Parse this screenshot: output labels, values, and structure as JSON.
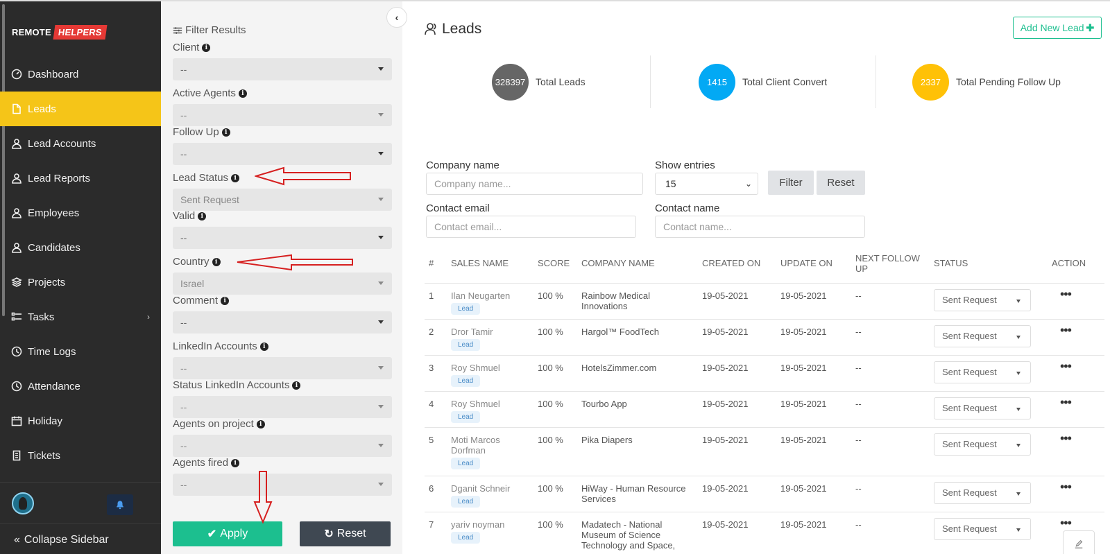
{
  "brand": {
    "part1": "REMOTE",
    "part2": "HELPERS"
  },
  "sidebar": {
    "items": [
      {
        "label": "Dashboard",
        "icon": "gauge-icon"
      },
      {
        "label": "Leads",
        "icon": "file-icon"
      },
      {
        "label": "Lead Accounts",
        "icon": "user-icon"
      },
      {
        "label": "Lead Reports",
        "icon": "user-icon"
      },
      {
        "label": "Employees",
        "icon": "user-icon"
      },
      {
        "label": "Candidates",
        "icon": "user-icon"
      },
      {
        "label": "Projects",
        "icon": "layers-icon"
      },
      {
        "label": "Tasks",
        "icon": "tasks-icon"
      },
      {
        "label": "Time Logs",
        "icon": "clock-icon"
      },
      {
        "label": "Attendance",
        "icon": "clock-icon"
      },
      {
        "label": "Holiday",
        "icon": "calendar-icon"
      },
      {
        "label": "Tickets",
        "icon": "ticket-icon"
      }
    ],
    "active": "Leads",
    "collapse_label": "Collapse Sidebar"
  },
  "filter": {
    "title": "Filter Results",
    "fields": [
      {
        "label": "Client",
        "value": "--"
      },
      {
        "label": "Active Agents",
        "value": "--"
      },
      {
        "label": "Follow Up",
        "value": "--"
      },
      {
        "label": "Lead Status",
        "value": "Sent Request"
      },
      {
        "label": "Valid",
        "value": "--"
      },
      {
        "label": "Country",
        "value": "Israel"
      },
      {
        "label": "Comment",
        "value": "--"
      },
      {
        "label": "LinkedIn Accounts",
        "value": "--"
      },
      {
        "label": "Status LinkedIn Accounts",
        "value": "--"
      },
      {
        "label": "Agents on project",
        "value": "--"
      },
      {
        "label": "Agents fired",
        "value": "--"
      }
    ],
    "apply_label": "Apply",
    "reset_label": "Reset"
  },
  "page": {
    "title": "Leads",
    "add_button": "Add New Lead"
  },
  "stats": [
    {
      "value": "328397",
      "label": "Total Leads",
      "color": "#666666"
    },
    {
      "value": "1415",
      "label": "Total Client Convert",
      "color": "#03a9f4"
    },
    {
      "value": "2337",
      "label": "Total Pending Follow Up",
      "color": "#ffc107"
    }
  ],
  "search": {
    "company_label": "Company name",
    "company_placeholder": "Company name...",
    "entries_label": "Show entries",
    "entries_value": "15",
    "filter_btn": "Filter",
    "reset_btn": "Reset",
    "email_label": "Contact email",
    "email_placeholder": "Contact email...",
    "contact_label": "Contact name",
    "contact_placeholder": "Contact name..."
  },
  "table": {
    "headers": [
      "#",
      "SALES NAME",
      "SCORE",
      "COMPANY NAME",
      "CREATED ON",
      "UPDATE ON",
      "NEXT FOLLOW UP",
      "STATUS",
      "ACTION"
    ],
    "badge": "Lead",
    "rows": [
      {
        "num": "1",
        "name": "Ilan Neugarten",
        "score": "100 %",
        "company": "Rainbow Medical Innovations",
        "created": "19-05-2021",
        "updated": "19-05-2021",
        "next": "--",
        "status": "Sent Request"
      },
      {
        "num": "2",
        "name": "Dror Tamir",
        "score": "100 %",
        "company": "Hargol™ FoodTech",
        "created": "19-05-2021",
        "updated": "19-05-2021",
        "next": "--",
        "status": "Sent Request"
      },
      {
        "num": "3",
        "name": "Roy Shmuel",
        "score": "100 %",
        "company": "HotelsZimmer.com",
        "created": "19-05-2021",
        "updated": "19-05-2021",
        "next": "--",
        "status": "Sent Request"
      },
      {
        "num": "4",
        "name": "Roy Shmuel",
        "score": "100 %",
        "company": "Tourbo App",
        "created": "19-05-2021",
        "updated": "19-05-2021",
        "next": "--",
        "status": "Sent Request"
      },
      {
        "num": "5",
        "name": "Moti Marcos Dorfman",
        "score": "100 %",
        "company": "Pika Diapers",
        "created": "19-05-2021",
        "updated": "19-05-2021",
        "next": "--",
        "status": "Sent Request"
      },
      {
        "num": "6",
        "name": "Dganit Schneir",
        "score": "100 %",
        "company": "HiWay - Human Resource Services",
        "created": "19-05-2021",
        "updated": "19-05-2021",
        "next": "--",
        "status": "Sent Request"
      },
      {
        "num": "7",
        "name": "yariv noyman",
        "score": "100 %",
        "company": "Madatech - National Museum of Science Technology and Space,",
        "created": "19-05-2021",
        "updated": "19-05-2021",
        "next": "--",
        "status": "Sent Request"
      }
    ]
  }
}
